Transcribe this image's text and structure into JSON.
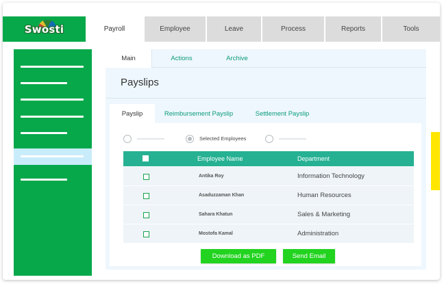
{
  "app": {
    "logo_text": "Swosti"
  },
  "top_nav": {
    "tabs": [
      {
        "label": "Payroll",
        "active": true
      },
      {
        "label": "Employee",
        "active": false
      },
      {
        "label": "Leave",
        "active": false
      },
      {
        "label": "Process",
        "active": false
      },
      {
        "label": "Reports",
        "active": false
      },
      {
        "label": "Tools",
        "active": false
      }
    ]
  },
  "sidebar": {
    "item_count": 7,
    "active_index": 6
  },
  "content": {
    "subtabs": [
      {
        "label": "Main",
        "active": true
      },
      {
        "label": "Actions",
        "active": false
      },
      {
        "label": "Archive",
        "active": false
      }
    ],
    "page_title": "Payslips",
    "inner_tabs": [
      {
        "label": "Payslip",
        "active": true
      },
      {
        "label": "Reimbursement Payslip",
        "active": false
      },
      {
        "label": "Settlement Payslip",
        "active": false
      }
    ],
    "radio_options": [
      {
        "label": "",
        "checked": false
      },
      {
        "label": "Selected Employees",
        "checked": true
      },
      {
        "label": "",
        "checked": false
      }
    ],
    "table": {
      "columns": [
        "Employee Name",
        "Department"
      ],
      "rows": [
        {
          "name": "Antika Roy",
          "department": "Information Technology"
        },
        {
          "name": "Asaduzzaman Khan",
          "department": "Human Resources"
        },
        {
          "name": "Sahara Khatun",
          "department": "Sales & Marketing"
        },
        {
          "name": "Mostofa Kamal",
          "department": "Administration"
        }
      ]
    },
    "buttons": {
      "download_pdf": "Download as PDF",
      "send_email": "Send Email"
    }
  },
  "colors": {
    "brand_green": "#06a84a",
    "table_header": "#26b193",
    "button_green": "#22d320",
    "accent_link": "#0b9a7a",
    "scroll_handle": "#ffe600"
  }
}
